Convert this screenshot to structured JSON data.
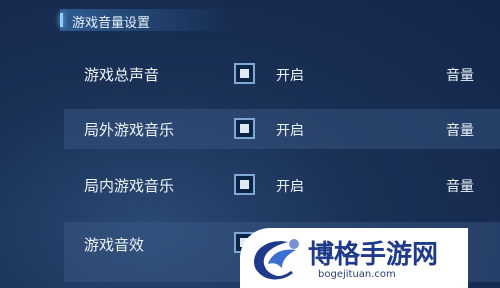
{
  "header": {
    "title": "游戏音量设置"
  },
  "rows": [
    {
      "label": "游戏总声音",
      "toggle_label": "开启",
      "checked": true,
      "volume_label": "音量"
    },
    {
      "label": "局外游戏音乐",
      "toggle_label": "开启",
      "checked": true,
      "volume_label": "音量"
    },
    {
      "label": "局内游戏音乐",
      "toggle_label": "开启",
      "checked": true,
      "volume_label": "音量"
    },
    {
      "label": "游戏音效",
      "checked": true
    }
  ],
  "watermark": {
    "title": "博格手游网",
    "url": "bogejituan.com"
  },
  "colors": {
    "background": "#1a3055",
    "row_highlight": "#3c5c87",
    "accent": "#8fd0ff",
    "watermark_text": "#1f3a8a"
  }
}
